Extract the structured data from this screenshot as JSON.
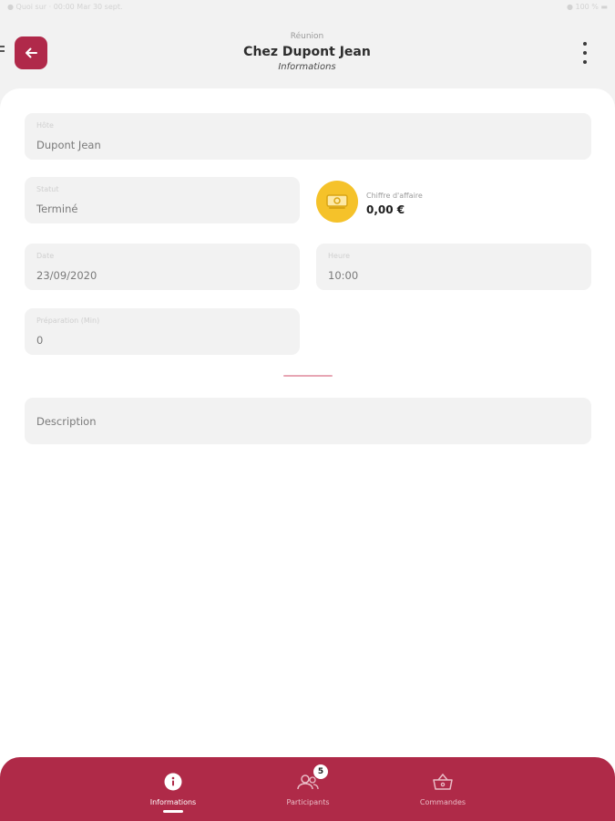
{
  "status_bar": {
    "left": "● Quoi sur · 00:00 Mar 30 sept.",
    "right": "● 100 % ▬"
  },
  "header": {
    "kicker": "Réunion",
    "title": "Chez Dupont Jean",
    "subtitle": "Informations"
  },
  "form": {
    "hote": {
      "label": "Hôte",
      "value": "Dupont Jean"
    },
    "statut": {
      "label": "Statut",
      "value": "Terminé"
    },
    "chiffre_affaire": {
      "label": "Chiffre d'affaire",
      "value": "0,00 €"
    },
    "date": {
      "label": "Date",
      "value": "23/09/2020"
    },
    "heure": {
      "label": "Heure",
      "value": "10:00"
    },
    "preparation": {
      "label": "Préparation (Min)",
      "value": "0"
    },
    "description": {
      "placeholder": "Description"
    }
  },
  "bottom_nav": {
    "items": [
      {
        "label": "Informations",
        "icon": "info-icon",
        "active": true
      },
      {
        "label": "Participants",
        "icon": "participants-icon",
        "badge": "5"
      },
      {
        "label": "Commandes",
        "icon": "basket-icon"
      }
    ]
  },
  "colors": {
    "primary": "#af2a48",
    "accent": "#f5c22a",
    "field_bg": "#f2f2f2"
  }
}
